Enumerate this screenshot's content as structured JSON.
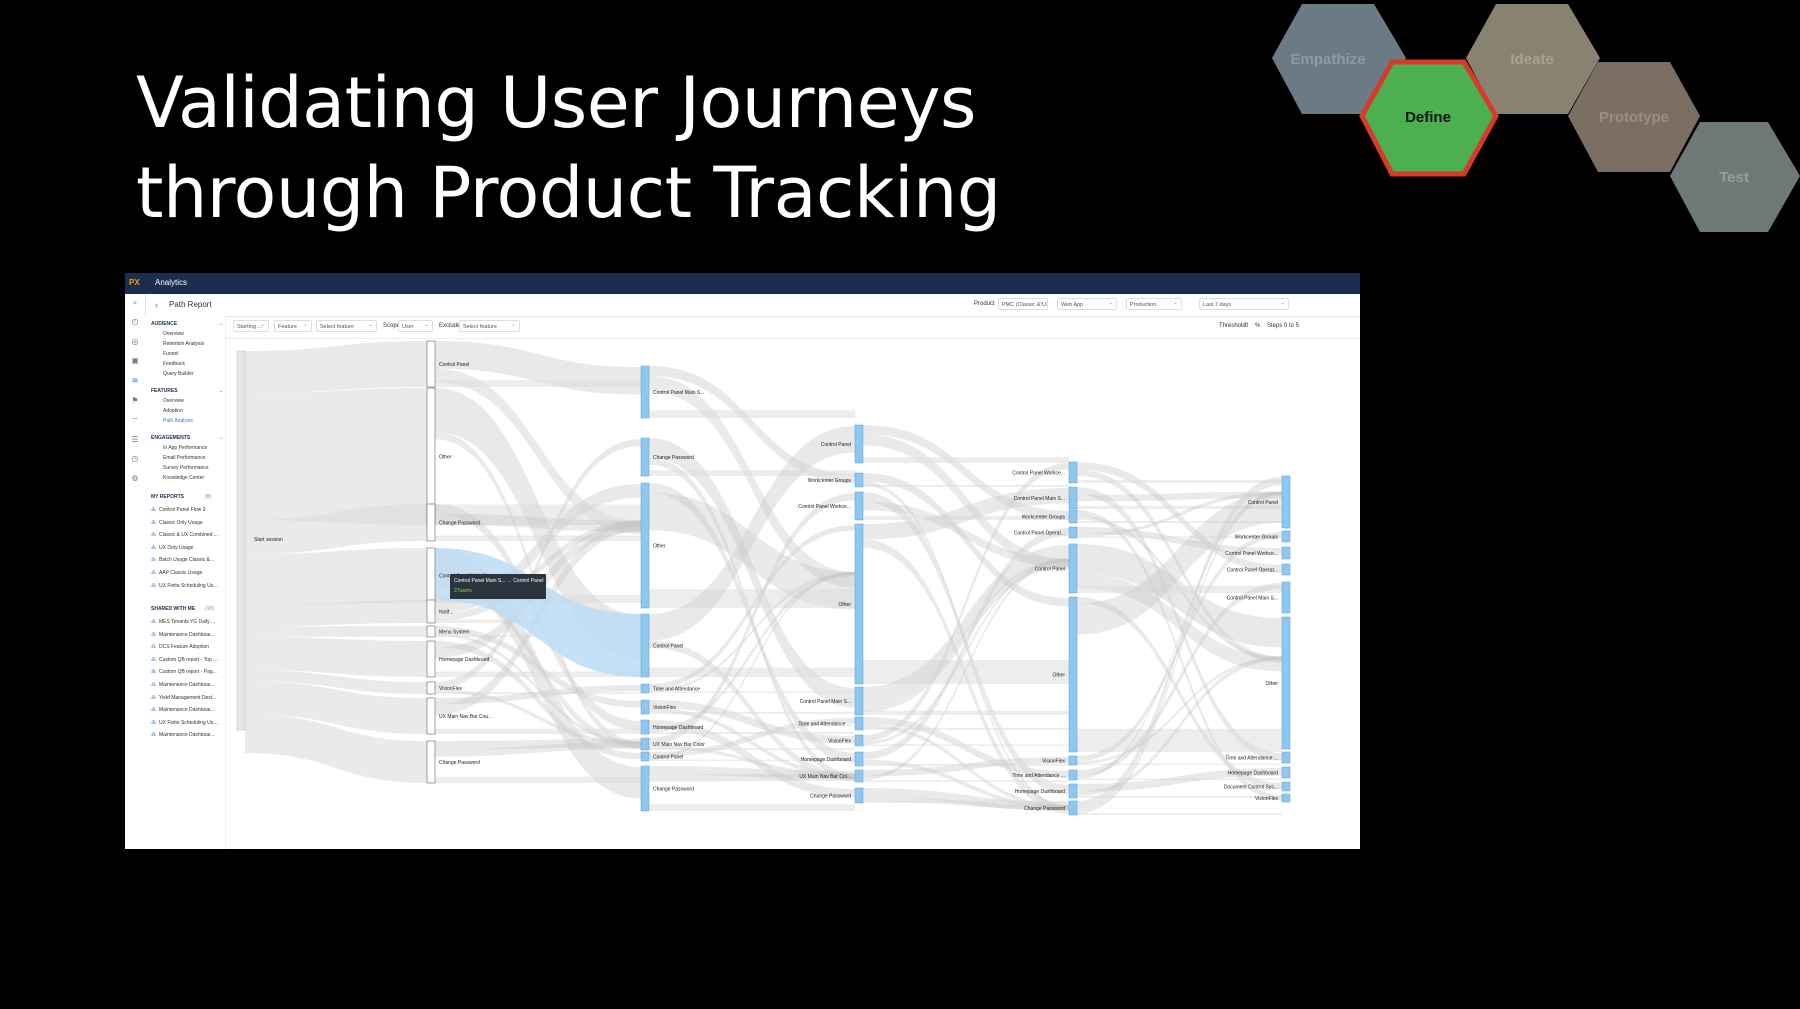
{
  "slide": {
    "title_line1": "Validating User Journeys",
    "title_line2": "through Product Tracking"
  },
  "design_stages": [
    {
      "label": "Empathize",
      "fill": "#6a7b86",
      "text_color": "#8a9aa6"
    },
    {
      "label": "Define",
      "fill": "#4caf50",
      "text_color": "#111111",
      "outline": "#d83a2a",
      "active": true
    },
    {
      "label": "Ideate",
      "fill": "#8a8270",
      "text_color": "#aaa290"
    },
    {
      "label": "Prototype",
      "fill": "#7b6e62",
      "text_color": "#9a8e82"
    },
    {
      "label": "Test",
      "fill": "#6e7874",
      "text_color": "#949e9a"
    }
  ],
  "app": {
    "logo": "PX",
    "name": "Analytics",
    "back_icon": "‹",
    "page_title": "Path Report",
    "header_filters": {
      "product_label": "Product",
      "product_value": "PMC (Classic & UX)",
      "app_value": "Web App",
      "env_value": "Production",
      "date_value": "Last 7 days"
    },
    "toolbar": {
      "starting": "Starting ...",
      "feature": "Feature",
      "select_feature": "Select feature",
      "scope_label": "Scope",
      "scope_value": "User",
      "exclude_label": "Exclude",
      "exclude_value": "Select feature",
      "threshold_label": "Threshold",
      "threshold_value": "0",
      "threshold_unit": "%",
      "steps": "Steps 0 to 5"
    },
    "nav": {
      "audience": "AUDIENCE",
      "audience_items": [
        "Overview",
        "Retention Analysis",
        "Funnel",
        "Feedback",
        "Query Builder"
      ],
      "features": "FEATURES",
      "features_items": [
        "Overview",
        "Adoption",
        "Path Analysis"
      ],
      "engagements": "ENGAGEMENTS",
      "engagements_items": [
        "In App Performance",
        "Email Performance",
        "Survey Performance",
        "Knowledge Center"
      ],
      "my_reports": "MY REPORTS",
      "my_reports_count": "(8)",
      "my_reports_items": [
        "Control Panel Flow 3",
        "Classic Only Usage",
        "Classic & UX Combined ...",
        "UX Only Usage",
        "Batch Usage Classic &...",
        "AAP Classic Usage",
        "UX Finite Scheduling Us..."
      ],
      "shared": "SHARED WITH ME",
      "shared_count": "(10)",
      "shared_items": [
        "MES Tenants YG Daily ...",
        "Maintenance Dashboar...",
        "DCS Feature Adoption",
        "Custom QB report - Top ...",
        "Custom QB report - Pag...",
        "Maintenance Dashboar...",
        "Yield Management Dest...",
        "Maintenance Dashboar...",
        "UX Finite Scheduling Us...",
        "Maintenance Dashboar..."
      ]
    },
    "sankey": {
      "start_label": "Start session",
      "tooltip_title": "Control Panel Main S... → Control Panel",
      "tooltip_value": "27users",
      "columns": [
        [
          "Control Panel",
          "Other",
          "Change Password",
          "Control Panel Main S...",
          "Notif...",
          "Menu System",
          "Homepage Dashboard",
          "VisionFlex",
          "UX Main Nav Bar Cou...",
          "Change Password"
        ],
        [
          "Control Panel Main S...",
          "Change Password",
          "Other",
          "Control Panel",
          "Time and Attendance",
          "VisionFlex",
          "Homepage Dashboard",
          "UX Main Nav Bar Color",
          "Control Panel",
          "Change Password"
        ],
        [
          "Control Panel",
          "Workcenter Groups",
          "Control Panel Workce...",
          "Other",
          "Control Panel Main S...",
          "Time and Attendance ...",
          "VisionFlex",
          "Homepage Dashboard",
          "UX Main Nav Bar Col...",
          "Change Password"
        ],
        [
          "Control Panel Workce...",
          "Control Panel Main S...",
          "Workcenter Groups",
          "Control Panel Operat...",
          "Control Panel",
          "Other",
          "VisionFlex",
          "Time and Attendance ...",
          "Homepage Dashboard",
          "Change Password"
        ],
        [
          "Control Panel",
          "Workcenter Groups",
          "Control Panel Workce...",
          "Control Panel Operat...",
          "Control Panel Main S...",
          "Other",
          "Time and Attendance ...",
          "Homepage Dashboard",
          "Document Control Sys...",
          "VisionFlex"
        ]
      ]
    }
  }
}
